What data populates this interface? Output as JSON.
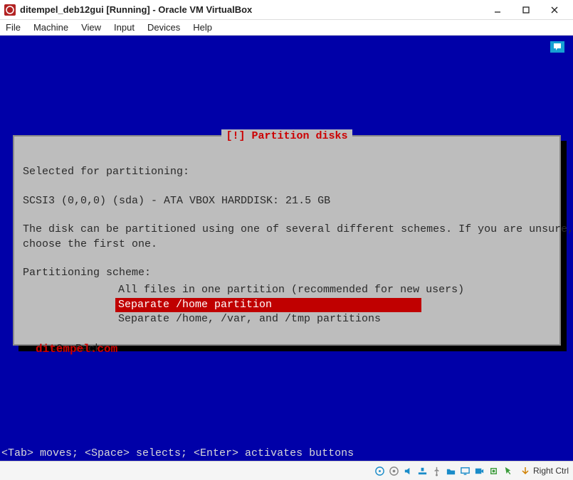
{
  "window": {
    "title": "ditempel_deb12gui [Running] - Oracle VM VirtualBox"
  },
  "menu": {
    "file": "File",
    "machine": "Machine",
    "view": "View",
    "input": "Input",
    "devices": "Devices",
    "help": "Help"
  },
  "dialog": {
    "title": "[!] Partition disks",
    "line1": "Selected for partitioning:",
    "line2": "SCSI3 (0,0,0) (sda) - ATA VBOX HARDDISK: 21.5 GB",
    "line3": "The disk can be partitioned using one of several different schemes. If you are unsure,",
    "line4": "choose the first one.",
    "line5": "Partitioning scheme:",
    "options": {
      "opt1": "All files in one partition (recommended for new users)",
      "opt2": "Separate /home partition",
      "opt3": "Separate /home, /var, and /tmp partitions"
    },
    "go_back": "<Go Back>"
  },
  "watermark": "ditempel.com",
  "help_line": "<Tab> moves; <Space> selects; <Enter> activates buttons",
  "statusbar": {
    "host_key": "Right Ctrl"
  }
}
